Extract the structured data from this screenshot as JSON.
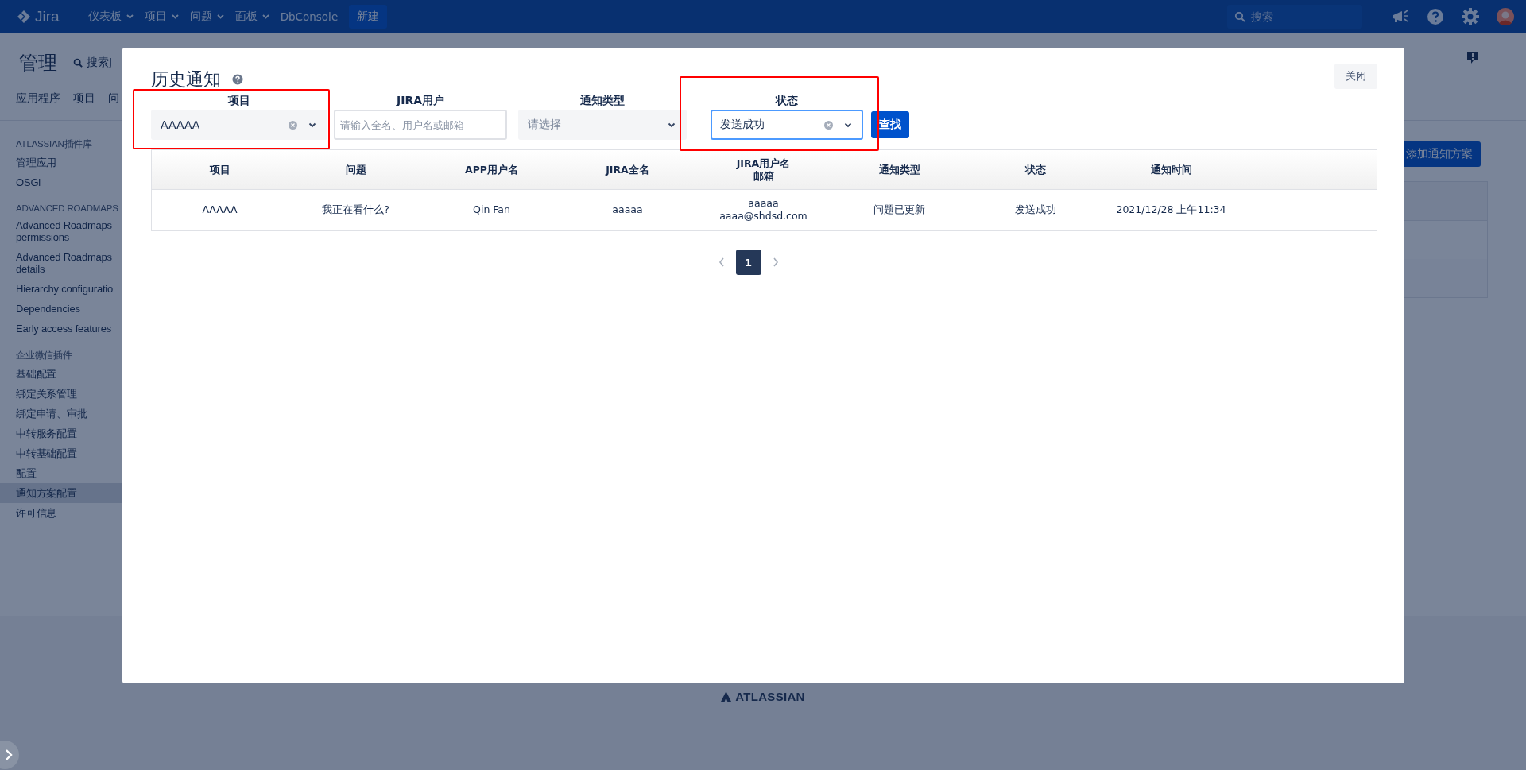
{
  "topbar": {
    "logo": "Jira",
    "menus": [
      {
        "label": "仪表板",
        "dropdown": true
      },
      {
        "label": "项目",
        "dropdown": true
      },
      {
        "label": "问题",
        "dropdown": true
      },
      {
        "label": "面板",
        "dropdown": true
      },
      {
        "label": "DbConsole",
        "dropdown": false
      }
    ],
    "create": "新建",
    "search": {
      "placeholder": "搜索"
    }
  },
  "admin": {
    "title": "管理",
    "search": "搜索J",
    "tabs": [
      "应用程序",
      "项目",
      "问"
    ]
  },
  "sidebar": [
    {
      "heading": "ATLASSIAN插件库",
      "items": [
        {
          "label": "管理应用",
          "selected": false
        },
        {
          "label": "OSGi",
          "selected": false
        }
      ]
    },
    {
      "heading": "ADVANCED ROADMAPS",
      "items": [
        {
          "label": "Advanced Roadmaps permissions",
          "selected": false
        },
        {
          "label": "Advanced Roadmaps details",
          "selected": false
        },
        {
          "label": "Hierarchy configuratio",
          "selected": false
        },
        {
          "label": "Dependencies",
          "selected": false
        },
        {
          "label": "Early access features",
          "selected": false
        }
      ]
    },
    {
      "heading": "企业微信插件",
      "items": [
        {
          "label": "基础配置",
          "selected": false
        },
        {
          "label": "绑定关系管理",
          "selected": false
        },
        {
          "label": "绑定申请、审批",
          "selected": false
        },
        {
          "label": "中转服务配置",
          "selected": false
        },
        {
          "label": "中转基础配置",
          "selected": false
        },
        {
          "label": "配置",
          "selected": false
        },
        {
          "label": "通知方案配置",
          "selected": true
        },
        {
          "label": "许可信息",
          "selected": false
        }
      ]
    }
  ],
  "main": {
    "add_button": "添加通知方案"
  },
  "modal": {
    "title": "历史通知",
    "close": "关闭",
    "filters": [
      {
        "kind": "select",
        "label": "项目",
        "value": "AAAAA",
        "focused": false,
        "highlighted": true
      },
      {
        "kind": "input",
        "label": "JIRA用户",
        "placeholder": "请输入全名、用户名或邮箱",
        "focused": false,
        "highlighted": false
      },
      {
        "kind": "select",
        "label": "通知类型",
        "placeholder": "请选择",
        "focused": false,
        "highlighted": false
      },
      {
        "kind": "select",
        "label": "状态",
        "value": "发送成功",
        "focused": true,
        "highlighted": true
      }
    ],
    "search_button": "查找",
    "table": {
      "columns": [
        "项目",
        "问题",
        "APP用户名",
        "JIRA全名",
        "JIRA用户名邮箱",
        "通知类型",
        "状态",
        "通知时间"
      ],
      "rows": [
        [
          "AAAAA",
          "我正在看什么?",
          "Qin Fan",
          "aaaaa",
          "aaaaa\naaaa@shdsd.com",
          "问题已更新",
          "发送成功",
          "2021/12/28 上午11:34"
        ]
      ]
    },
    "pagination": {
      "pages": [
        {
          "label": "1",
          "selected": true
        }
      ]
    }
  },
  "footer": {
    "brand": "ATLASSIAN"
  }
}
